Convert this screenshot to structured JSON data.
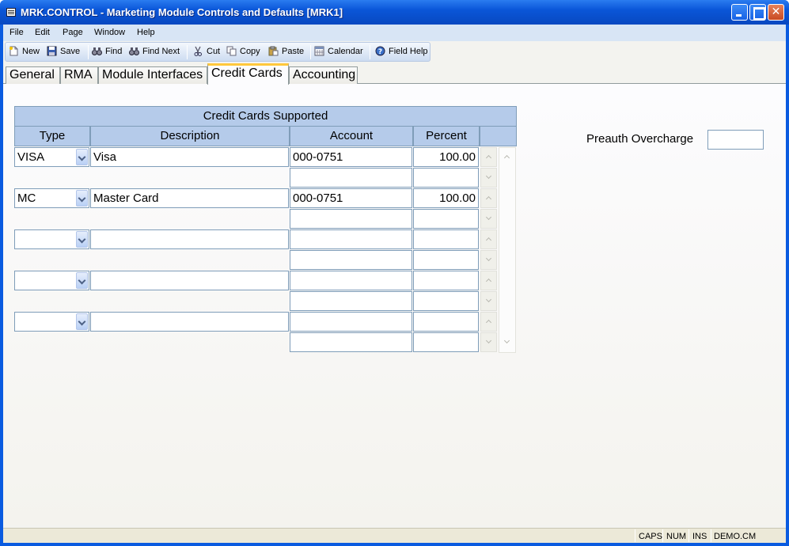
{
  "window": {
    "title": "MRK.CONTROL - Marketing Module Controls and Defaults [MRK1]"
  },
  "menu": [
    "File",
    "Edit",
    "Page",
    "Window",
    "Help"
  ],
  "toolbar": {
    "new": "New",
    "save": "Save",
    "find": "Find",
    "find_next": "Find Next",
    "cut": "Cut",
    "copy": "Copy",
    "paste": "Paste",
    "calendar": "Calendar",
    "field_help": "Field Help"
  },
  "tabs": [
    "General",
    "RMA",
    "Module Interfaces",
    "Credit Cards",
    "Accounting"
  ],
  "active_tab": "Credit Cards",
  "grid": {
    "title": "Credit Cards Supported",
    "columns": [
      "Type",
      "Description",
      "Account",
      "Percent"
    ],
    "rows": [
      {
        "type": "VISA",
        "description": "Visa",
        "account": "000-0751",
        "percent": "100.00"
      },
      {
        "type": "MC",
        "description": "Master Card",
        "account": "000-0751",
        "percent": "100.00"
      },
      {
        "type": "",
        "description": "",
        "account": "",
        "percent": ""
      },
      {
        "type": "",
        "description": "",
        "account": "",
        "percent": ""
      },
      {
        "type": "",
        "description": "",
        "account": "",
        "percent": ""
      }
    ]
  },
  "preauth": {
    "label": "Preauth Overcharge",
    "value": ""
  },
  "status": [
    "CAPS",
    "NUM",
    "INS",
    "DEMO.CM"
  ]
}
